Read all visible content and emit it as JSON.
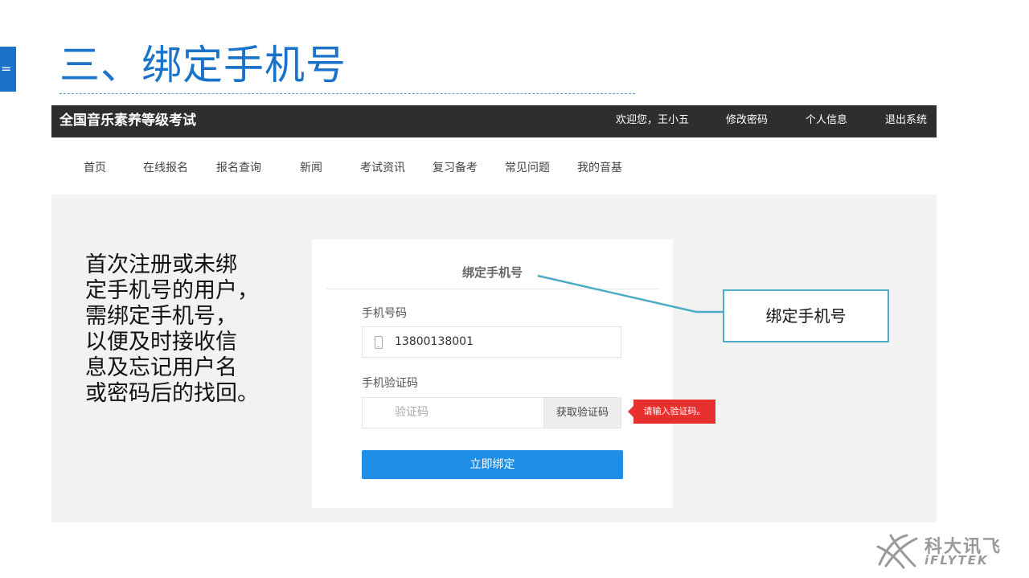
{
  "slide": {
    "side_tab_text": "=",
    "title": "三、绑定手机号"
  },
  "topbar": {
    "brand": "全国音乐素养等级考试",
    "links": [
      "欢迎您，王小五",
      "修改密码",
      "个人信息",
      "退出系统"
    ]
  },
  "nav": {
    "items": [
      "首页",
      "在线报名",
      "报名查询",
      "新闻",
      "考试资讯",
      "复习备考",
      "常见问题",
      "我的音基"
    ]
  },
  "description": {
    "lines": [
      "首次注册或未绑",
      "定手机号的用户，",
      "需绑定手机号，",
      "以便及时接收信",
      "息及忘记用户名",
      "或密码后的找回。"
    ]
  },
  "form": {
    "title": "绑定手机号",
    "phone_label": "手机号码",
    "phone_value": "13800138001",
    "code_label": "手机验证码",
    "code_placeholder": "验证码",
    "get_code_label": "获取验证码",
    "submit_label": "立即绑定",
    "error_text": "请输入验证码。"
  },
  "callout": {
    "text": "绑定手机号"
  },
  "logo": {
    "cn": "科大讯飞",
    "en": "iFLYTEK"
  },
  "colors": {
    "accent": "#1a73c8",
    "topbar": "#2e2e2e",
    "button": "#1e8ee6",
    "error": "#e8302e",
    "callout_border": "#4bacc6"
  }
}
